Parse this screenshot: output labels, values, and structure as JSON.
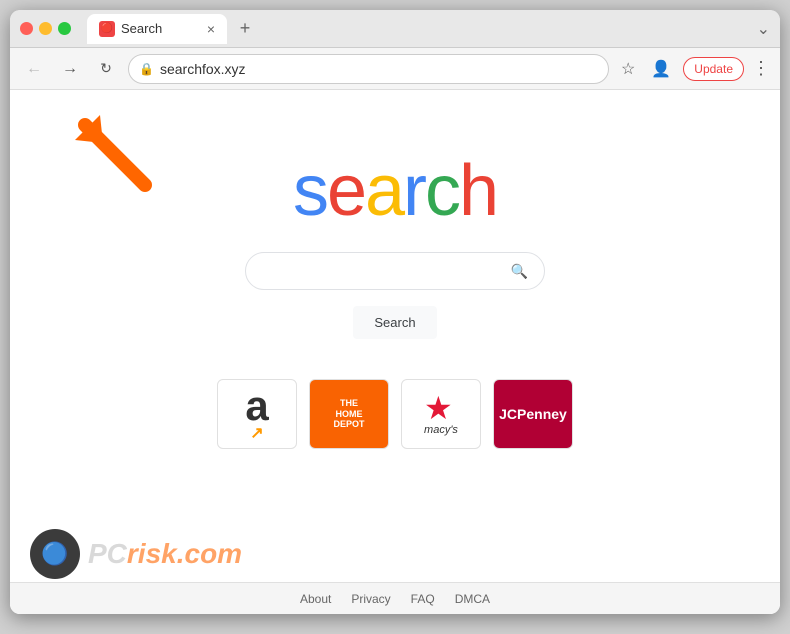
{
  "browser": {
    "tab_title": "Search",
    "tab_favicon": "S",
    "url": "searchfox.xyz",
    "update_button": "Update",
    "new_tab_icon": "+",
    "tab_menu_icon": "⌄"
  },
  "page": {
    "logo_letters": [
      "s",
      "e",
      "a",
      "r",
      "c",
      "h"
    ],
    "search_placeholder": "",
    "search_button_label": "Search",
    "shortcuts": [
      {
        "name": "Amazon",
        "type": "amazon"
      },
      {
        "name": "The Home Depot",
        "type": "homedepot"
      },
      {
        "name": "Macy's",
        "type": "macys"
      },
      {
        "name": "JCPenney",
        "type": "jcpenney"
      }
    ],
    "footer_links": [
      "About",
      "Privacy",
      "FAQ",
      "DMCA"
    ]
  },
  "watermark": {
    "text": "PC",
    "domain_prefix": "risk",
    "domain_suffix": ".com"
  }
}
